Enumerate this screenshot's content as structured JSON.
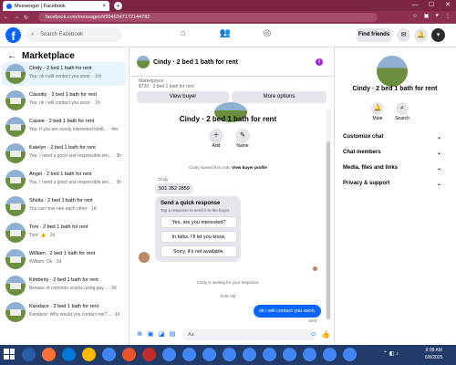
{
  "browser": {
    "tab_title": "Messenger | Facebook",
    "tab_close": "×",
    "new_tab": "+",
    "url": "facebook.com/messages/t/9946347172144782",
    "win_min": "—",
    "win_max": "☐",
    "win_close": "✕"
  },
  "fb": {
    "logo": "f",
    "search_placeholder": "Search Facebook",
    "find_friends": "Find friends"
  },
  "left": {
    "title": "Marketplace",
    "back": "←",
    "conversations": [
      {
        "name": "Cindy · 2 bed 1 bath for rent",
        "snippet": "You: ok i will contact you soon. · 1m",
        "active": true
      },
      {
        "name": "Cassitty · 2 bed 1 bath for rent",
        "snippet": "You: ok i will contact you soon. · 1h"
      },
      {
        "name": "Cassie · 2 bed 1 bath for rent",
        "snippet": "You: if you are surely interested kindl... · 4m"
      },
      {
        "name": "Katelyn · 2 bed 1 bath for rent",
        "snippet": "You: I need a good and responsible ten... · 3h"
      },
      {
        "name": "Angel · 2 bed 1 bath for rent",
        "snippet": "You: I need a good and responsible ten... · 3h"
      },
      {
        "name": "Sheila · 2 bed 1 bath for rent",
        "snippet": "You can now rate each other · 1d"
      },
      {
        "name": "Toni · 2 bed 1 bath for rent",
        "snippet": "Toni: 👍 · 2d"
      },
      {
        "name": "William · 2 bed 1 bath for rent",
        "snippet": "William: Ok · 2d"
      },
      {
        "name": "Kimberly · 2 bed 1 bath for rent",
        "snippet": "Beware of common scams using pay... · 3d"
      },
      {
        "name": "Kandace · 2 bed 1 bath for rent",
        "snippet": "Kandace: Why would you contact me?... · 3d"
      }
    ]
  },
  "chat": {
    "header_title": "Cindy · 2 bed 1 bath for rent",
    "info": "i",
    "marketplace_label": "Marketplace",
    "price_line": "$730 · 2 bed 1 bath for rent",
    "view_buyer": "View buyer",
    "more_options": "More options",
    "conv_title": "Cindy · 2 bed 1 bath for rent",
    "add_label": "Add",
    "name_label": "Name",
    "started_text": "Cindy started this chat.",
    "view_profile": "View buyer profile",
    "sender": "Cindy",
    "phone": "501 352 2859",
    "quick_title": "Send a quick response",
    "quick_sub": "Tap a response to send it to the buyer.",
    "quick_replies": [
      "Yes, are you interested?",
      "In talks. I'll let you know.",
      "Sorry, it's not available."
    ],
    "waiting": "Cindy is waiting for your response.",
    "time": "8:08 AM",
    "my_message": "ok i will contact you soon.",
    "sent": "Sent",
    "input_placeholder": "Aa"
  },
  "right": {
    "title": "Cindy · 2 bed 1 bath for rent",
    "mute": "Mute",
    "search": "Search",
    "items": [
      "Customize chat",
      "Chat members",
      "Media, files and links",
      "Privacy & support"
    ]
  },
  "taskbar": {
    "time": "8:08 AM",
    "date": "6/8/2025"
  }
}
